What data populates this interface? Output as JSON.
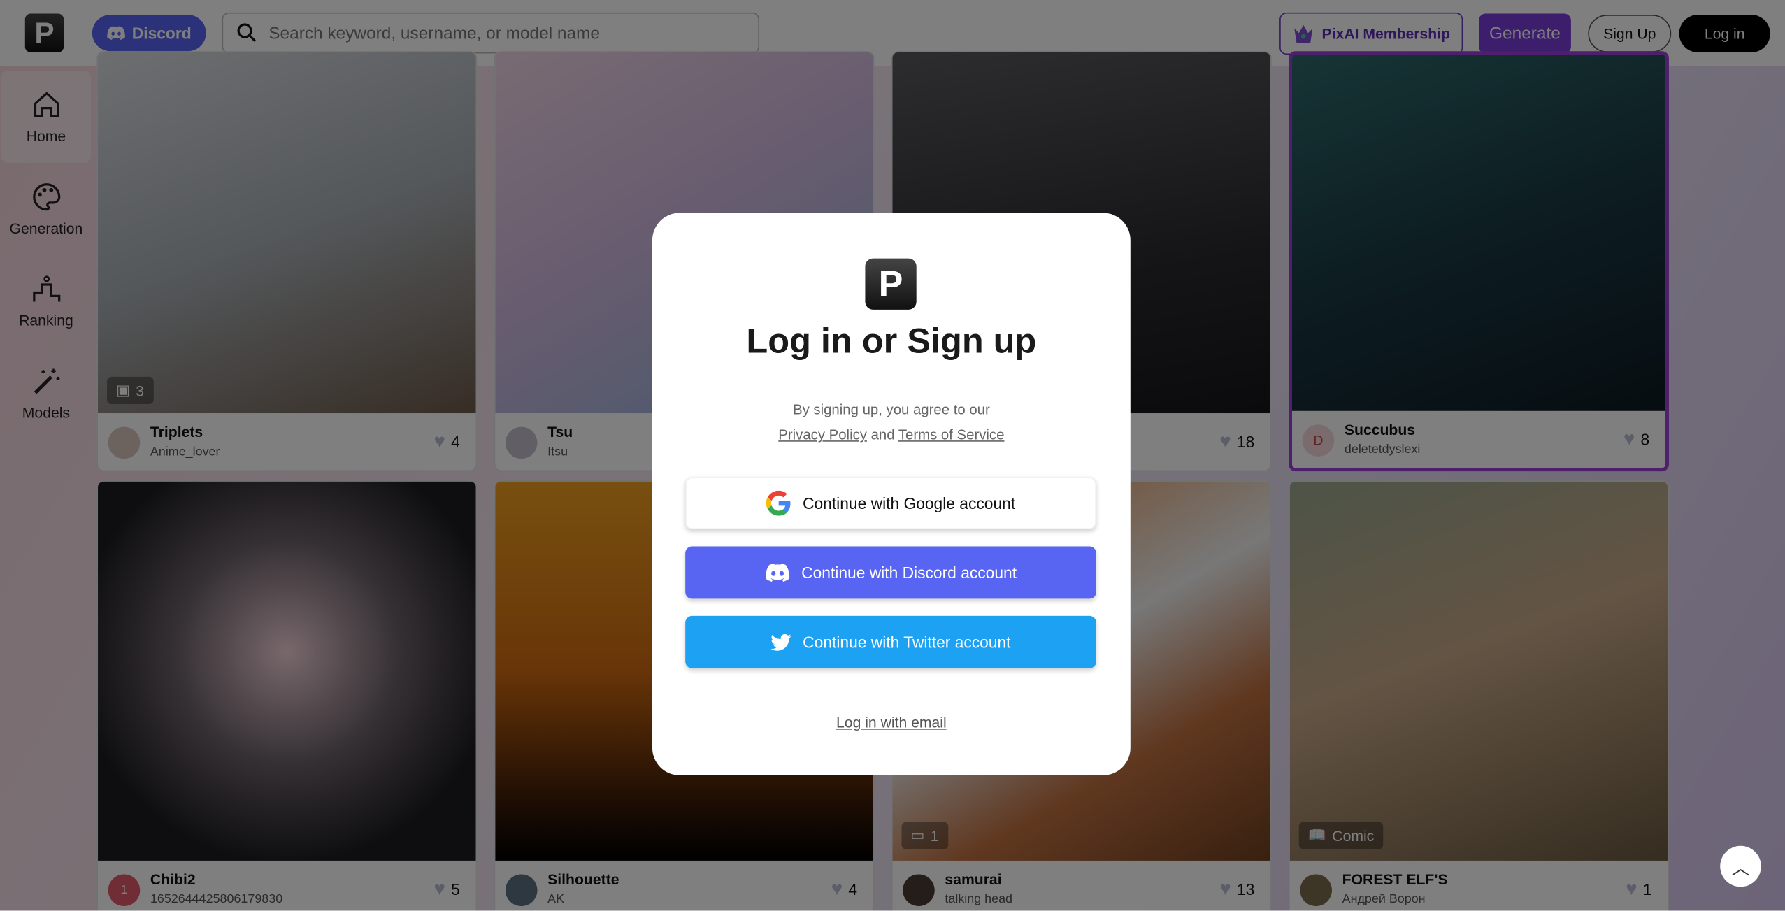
{
  "header": {
    "logo_letter": "P",
    "discord_label": "Discord",
    "search_placeholder": "Search keyword, username, or model name",
    "membership_label": "PixAI Membership",
    "generate_label": "Generate",
    "signup_label": "Sign Up",
    "login_label": "Log in"
  },
  "sidebar": {
    "items": [
      {
        "label": "Home",
        "icon": "home-icon",
        "active": true
      },
      {
        "label": "Generation",
        "icon": "palette-icon"
      },
      {
        "label": "Ranking",
        "icon": "ranking-icon"
      },
      {
        "label": "Models",
        "icon": "magic-wand-icon"
      }
    ]
  },
  "cards": [
    {
      "title": "Triplets",
      "user": "Anime_lover",
      "likes": "4",
      "badge": "3",
      "badge_icon": "gallery-icon"
    },
    {
      "title": "Tsu",
      "user": "Itsu",
      "likes": ""
    },
    {
      "title": "",
      "user": "",
      "likes": "18"
    },
    {
      "title": "Succubus",
      "user": "deletetdyslexi",
      "likes": "8",
      "avatar_letter": "D"
    },
    {
      "title": "Chibi2",
      "user": "1652644425806179830",
      "likes": "5",
      "avatar_letter": "1"
    },
    {
      "title": "Silhouette",
      "user": "AK",
      "likes": "4"
    },
    {
      "title": "samurai",
      "user": "talking head",
      "likes": "13",
      "badge": "1",
      "badge_icon": "comment-icon"
    },
    {
      "title": "FOREST ELF'S",
      "user": "Андрей Ворон",
      "likes": "1",
      "badge": "Comic",
      "badge_icon": "book-icon"
    }
  ],
  "modal": {
    "logo_letter": "P",
    "title": "Log in or Sign up",
    "terms_prefix": "By signing up, you agree to our",
    "privacy_link": "Privacy Policy",
    "and": "and",
    "terms_link": "Terms of Service",
    "google_label": "Continue with Google account",
    "discord_label": "Continue with Discord account",
    "twitter_label": "Continue with Twitter account",
    "email_label": "Log in with email"
  },
  "colors": {
    "discord": "#5865f2",
    "twitter": "#1da1f2",
    "generate": "#7a3ddb",
    "membership": "#5b2db8"
  }
}
